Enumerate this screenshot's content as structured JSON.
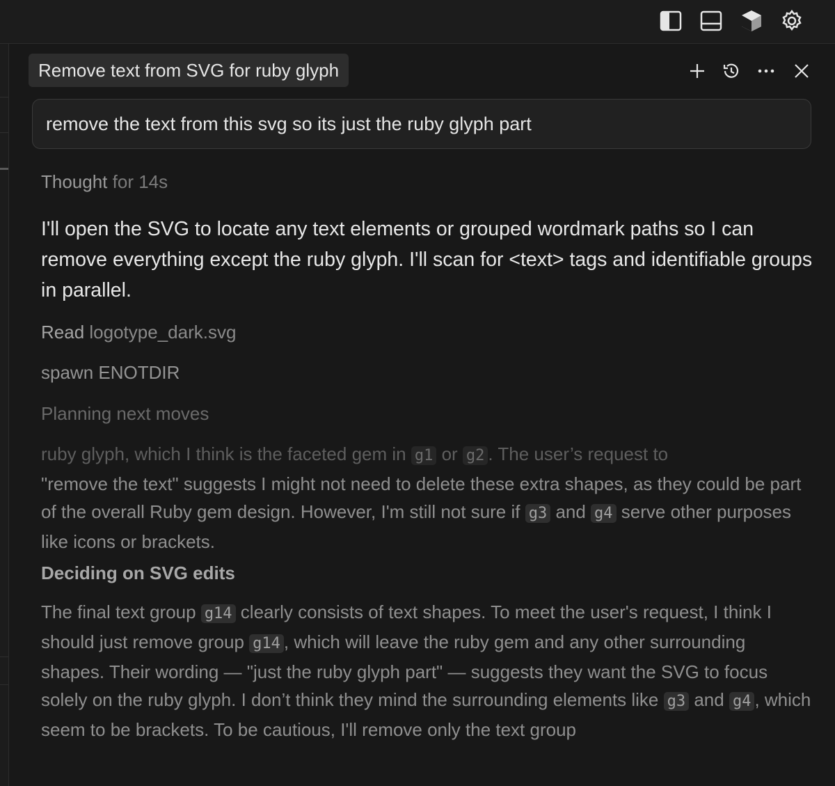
{
  "topbar": {
    "icons": [
      "toggle-sidebar-icon",
      "toggle-panel-icon",
      "cube-icon",
      "gear-icon"
    ]
  },
  "header": {
    "title": "Remove text from SVG for ruby glyph",
    "icons": [
      "plus-icon",
      "history-icon",
      "more-icon",
      "close-icon"
    ]
  },
  "prompt": {
    "text": "remove the text from this svg so its just the ruby glyph part"
  },
  "thought": {
    "label": "Thought",
    "duration": "for 14s"
  },
  "message": {
    "text": "I'll open the SVG to locate any text elements or grouped wordmark paths so I can remove everything except the ruby glyph. I'll scan for <text> tags and identifiable groups in parallel."
  },
  "steps": {
    "read_label": "Read",
    "read_file": "logotype_dark.svg",
    "spawn": "spawn ENOTDIR",
    "planning": "Planning next moves"
  },
  "reasoning1": {
    "s1": "ruby glyph, which I think is the faceted gem in ",
    "c1": "g1",
    "s2": " or ",
    "c2": "g2",
    "s3": ". The user’s request to",
    "s4": "\"remove the text\" suggests I might not need to delete these extra shapes, as they could be part of the overall Ruby gem design. However, I'm still not sure if ",
    "c3": "g3",
    "s5": " and ",
    "c4": "g4",
    "s6": " serve other purposes like icons or brackets."
  },
  "heading2": "Deciding on SVG edits",
  "reasoning2": {
    "s1": "The final text group ",
    "c1": "g14",
    "s2": " clearly consists of text shapes. To meet the user's request, I think I should just remove group ",
    "c2": "g14",
    "s3": ", which will leave the ruby gem and any other surrounding shapes. Their wording — \"just the ruby glyph part\" — suggests they want the SVG to focus solely on the ruby glyph. I don’t think they mind the surrounding elements like ",
    "c3": "g3",
    "s4": " and ",
    "c4": "g4",
    "s5": ", which seem to be brackets. To be cautious, I'll remove only the text group"
  }
}
